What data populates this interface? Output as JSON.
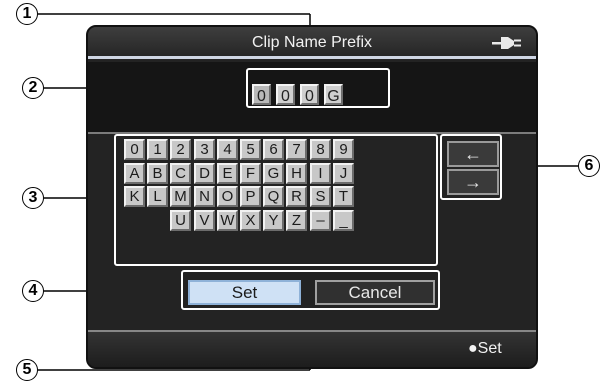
{
  "screen": {
    "title": "Clip Name Prefix",
    "power_icon": "ac-plug-icon",
    "prefix_chars": [
      "0",
      "0",
      "0",
      "G"
    ],
    "keyboard_rows": [
      [
        "0",
        "1",
        "2",
        "3",
        "4",
        "5",
        "6",
        "7",
        "8",
        "9"
      ],
      [
        "A",
        "B",
        "C",
        "D",
        "E",
        "F",
        "G",
        "H",
        "I",
        "J"
      ],
      [
        "K",
        "L",
        "M",
        "N",
        "O",
        "P",
        "Q",
        "R",
        "S",
        "T"
      ],
      [
        "U",
        "V",
        "W",
        "X",
        "Y",
        "Z",
        "–",
        "_"
      ]
    ],
    "cursor_left": "←",
    "cursor_right": "→",
    "set_label": "Set",
    "cancel_label": "Cancel",
    "status_set": "●Set"
  },
  "callouts": [
    "1",
    "2",
    "3",
    "4",
    "5",
    "6"
  ]
}
